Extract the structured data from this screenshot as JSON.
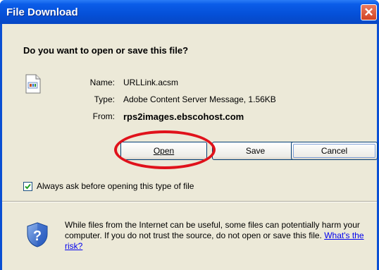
{
  "window": {
    "title": "File Download",
    "close_glyph": "✕"
  },
  "question": "Do you want to open or save this file?",
  "file": {
    "name_label": "Name:",
    "name_value": "URLLink.acsm",
    "type_label": "Type:",
    "type_value": "Adobe Content Server Message, 1.56KB",
    "from_label": "From:",
    "from_value": "rps2images.ebscohost.com"
  },
  "buttons": {
    "open_label": "Open",
    "save_label": "Save",
    "cancel_label": "Cancel"
  },
  "checkbox": {
    "checked": true,
    "label": "Always ask before opening this type of file"
  },
  "warning": {
    "text": "While files from the Internet can be useful, some files can potentially harm your computer. If you do not trust the source, do not open or save this file.",
    "link": "What's the risk?"
  },
  "colors": {
    "titlebar": "#0550d8",
    "dialog_bg": "#ece9d8",
    "highlight_ring": "#e0121b",
    "link": "#0000ee"
  },
  "icons": [
    "file-icon",
    "close-icon",
    "checkmark-icon",
    "shield-question-icon"
  ]
}
